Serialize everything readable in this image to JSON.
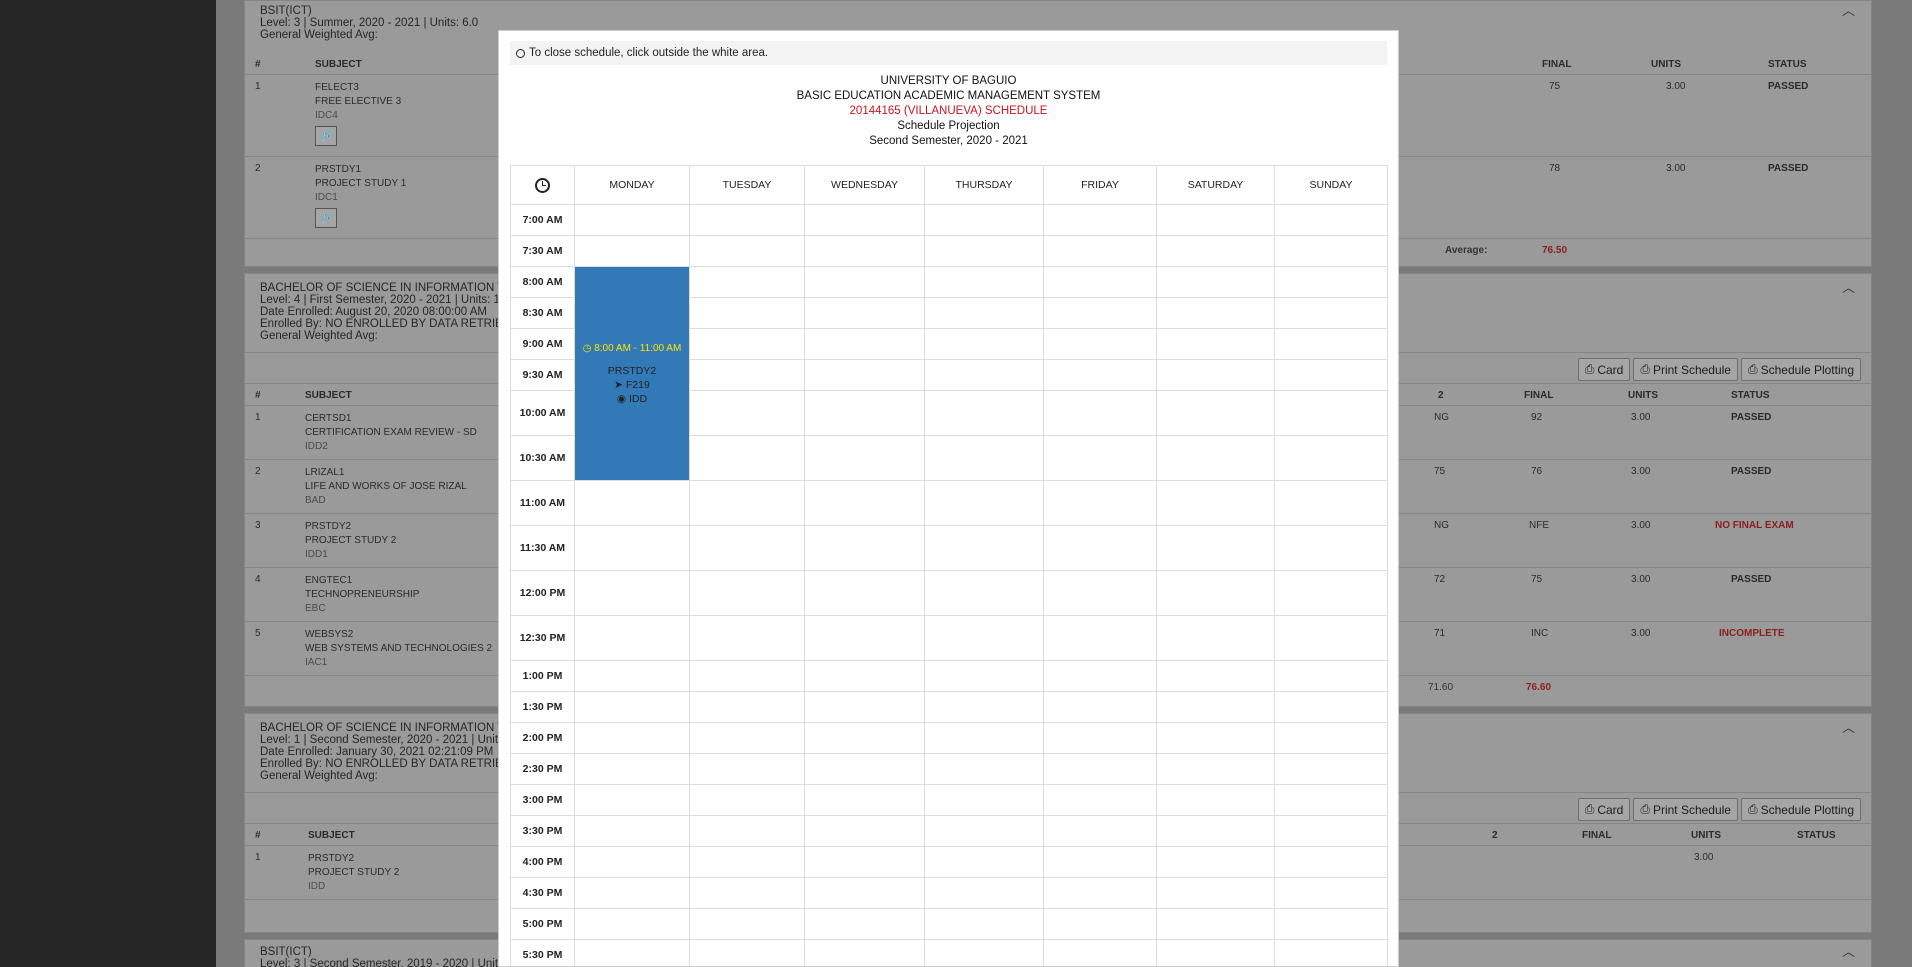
{
  "notice": "To close schedule, click outside the white area.",
  "header": {
    "university": "UNIVERSITY OF BAGUIO",
    "system": "BASIC EDUCATION ACADEMIC MANAGEMENT SYSTEM",
    "schedule_title": "20144165 (VILLANUEVA) SCHEDULE",
    "projection": "Schedule Projection",
    "term": "Second Semester, 2020 - 2021"
  },
  "days": [
    "MONDAY",
    "TUESDAY",
    "WEDNESDAY",
    "THURSDAY",
    "FRIDAY",
    "SATURDAY",
    "SUNDAY"
  ],
  "times": [
    "7:00 AM",
    "7:30 AM",
    "8:00 AM",
    "8:30 AM",
    "9:00 AM",
    "9:30 AM",
    "10:00 AM",
    "10:30 AM",
    "11:00 AM",
    "11:30 AM",
    "12:00 PM",
    "12:30 PM",
    "1:00 PM",
    "1:30 PM",
    "2:00 PM",
    "2:30 PM",
    "3:00 PM",
    "3:30 PM",
    "4:00 PM",
    "4:30 PM",
    "5:00 PM",
    "5:30 PM"
  ],
  "event": {
    "time": "8:00 AM - 11:00 AM",
    "subject": "PRSTDY2",
    "room": "F219",
    "instructor": "IDD"
  },
  "bg": {
    "p1": {
      "title": "BSIT(ICT)",
      "line1": "Level: 3 | Summer, 2020 - 2021 | Units: 6.0",
      "line2": "General Weighted Avg:",
      "h": {
        "num": "#",
        "subject": "SUBJECT",
        "final": "FINAL",
        "units": "UNITS",
        "status": "STATUS"
      },
      "rows": [
        {
          "num": "1",
          "code": "FELECT3",
          "name": "FREE ELECTIVE 3",
          "room": "IDC4",
          "final": "75",
          "units": "3.00",
          "status": "PASSED"
        },
        {
          "num": "2",
          "code": "PRSTDY1",
          "name": "PROJECT STUDY 1",
          "room": "IDC1",
          "final": "78",
          "units": "3.00",
          "status": "PASSED"
        }
      ],
      "avg_label": "Average:",
      "avg_value": "76.50"
    },
    "p2": {
      "title": "BACHELOR OF SCIENCE IN INFORMATION TE",
      "line1": "Level: 4 | First Semester, 2020 - 2021 | Units: 1",
      "line2": "Date Enrolled: August 20, 2020 08:00:00 AM",
      "line3": "Enrolled By: NO ENROLLED BY DATA RETRIEV",
      "line4": "General Weighted Avg:",
      "btn_card": "Card",
      "btn_print": "Print Schedule",
      "btn_plot": "Schedule Plotting",
      "h": {
        "num": "#",
        "subject": "SUBJECT",
        "mid": "2",
        "final": "FINAL",
        "units": "UNITS",
        "status": "STATUS"
      },
      "rows": [
        {
          "num": "1",
          "code": "CERTSD1",
          "name": "CERTIFICATION EXAM REVIEW - SD",
          "room": "IDD2",
          "mid": "NG",
          "final": "92",
          "units": "3.00",
          "status": "PASSED"
        },
        {
          "num": "2",
          "code": "LRIZAL1",
          "name": "LIFE AND WORKS OF JOSE RIZAL",
          "room": "BAD",
          "mid": "75",
          "final": "76",
          "units": "3.00",
          "status": "PASSED"
        },
        {
          "num": "3",
          "code": "PRSTDY2",
          "name": "PROJECT STUDY 2",
          "room": "IDD1",
          "mid": "NG",
          "final": "NFE",
          "units": "3.00",
          "status": "NO FINAL EXAM"
        },
        {
          "num": "4",
          "code": "ENGTEC1",
          "name": "TECHNOPRENEURSHIP",
          "room": "EBC",
          "mid": "72",
          "final": "75",
          "units": "3.00",
          "status": "PASSED"
        },
        {
          "num": "5",
          "code": "WEBSYS2",
          "name": "WEB SYSTEMS AND TECHNOLOGIES 2",
          "room": "IAC1",
          "mid": "71",
          "final": "INC",
          "units": "3.00",
          "status": "INCOMPLETE"
        }
      ],
      "avg_mid": "71.60",
      "avg_final": "76.60"
    },
    "p3": {
      "title": "BACHELOR OF SCIENCE IN INFORMATION TE",
      "line1": "Level: 1 | Second Semester, 2020 - 2021 | Units",
      "line2": "Date Enrolled: January 30, 2021 02:21:09 PM",
      "line3": "Enrolled By: NO ENROLLED BY DATA RETRIEV",
      "line4": "General Weighted Avg:",
      "btn_card": "Card",
      "btn_print": "Print Schedule",
      "btn_plot": "Schedule Plotting",
      "h": {
        "num": "#",
        "subject": "SUBJECT",
        "mid": "2",
        "final": "FINAL",
        "units": "UNITS",
        "status": "STATUS"
      },
      "row": {
        "num": "1",
        "code": "PRSTDY2",
        "name": "PROJECT STUDY 2",
        "room": "IDD",
        "units": "3.00"
      }
    },
    "p4": {
      "title": "BSIT(ICT)",
      "line1": "Level: 3 | Second Semester, 2019 - 2020 | Unit"
    }
  }
}
